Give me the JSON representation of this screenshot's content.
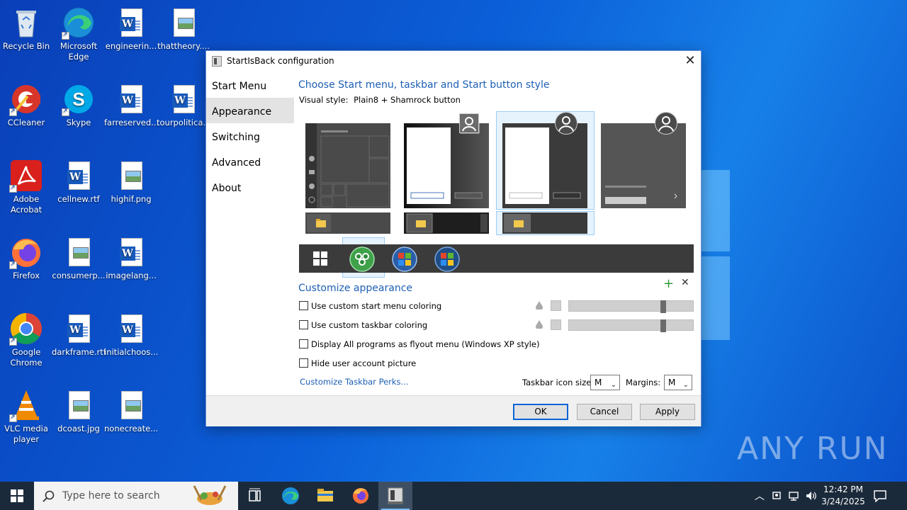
{
  "desktop": {
    "icons": [
      {
        "label": "Recycle Bin",
        "label2": ""
      },
      {
        "label": "Microsoft",
        "label2": "Edge"
      },
      {
        "label": "engineerin...",
        "label2": ""
      },
      {
        "label": "thattheory....",
        "label2": ""
      },
      {
        "label": "CCleaner",
        "label2": ""
      },
      {
        "label": "Skype",
        "label2": ""
      },
      {
        "label": "farreserved...",
        "label2": ""
      },
      {
        "label": "tourpolitica...",
        "label2": ""
      },
      {
        "label": "Adobe",
        "label2": "Acrobat"
      },
      {
        "label": "cellnew.rtf",
        "label2": ""
      },
      {
        "label": "highif.png",
        "label2": ""
      },
      {
        "label": "Firefox",
        "label2": ""
      },
      {
        "label": "consumerp...",
        "label2": ""
      },
      {
        "label": "imagelang...",
        "label2": ""
      },
      {
        "label": "Google",
        "label2": "Chrome"
      },
      {
        "label": "darkframe.rtf",
        "label2": ""
      },
      {
        "label": "initialchoos...",
        "label2": ""
      },
      {
        "label": "VLC media",
        "label2": "player"
      },
      {
        "label": "dcoast.jpg",
        "label2": ""
      },
      {
        "label": "nonecreate...",
        "label2": ""
      }
    ],
    "watermark": "ANY RUN"
  },
  "dialog": {
    "title": "StartIsBack configuration",
    "nav": [
      "Start Menu",
      "Appearance",
      "Switching",
      "Advanced",
      "About"
    ],
    "selected_nav": "Appearance",
    "heading": "Choose Start menu, taskbar and Start button style",
    "visual_style_label": "Visual style:",
    "visual_style_value": "Plain8 + Shamrock button",
    "customize_heading": "Customize appearance",
    "checks": [
      {
        "label": "Use custom start menu coloring",
        "checked": false
      },
      {
        "label": "Use custom taskbar coloring",
        "checked": false
      },
      {
        "label": "Display All programs as flyout menu (Windows XP style)",
        "checked": false
      },
      {
        "label": "Hide user account picture",
        "checked": false
      }
    ],
    "perks_link": "Customize Taskbar Perks...",
    "icon_size_label": "Taskbar icon size:",
    "icon_size_value": "M",
    "margins_label": "Margins:",
    "margins_value": "M",
    "ok": "OK",
    "cancel": "Cancel",
    "apply": "Apply"
  },
  "taskbar": {
    "search_placeholder": "Type here to search",
    "time": "12:42 PM",
    "date": "3/24/2025"
  }
}
